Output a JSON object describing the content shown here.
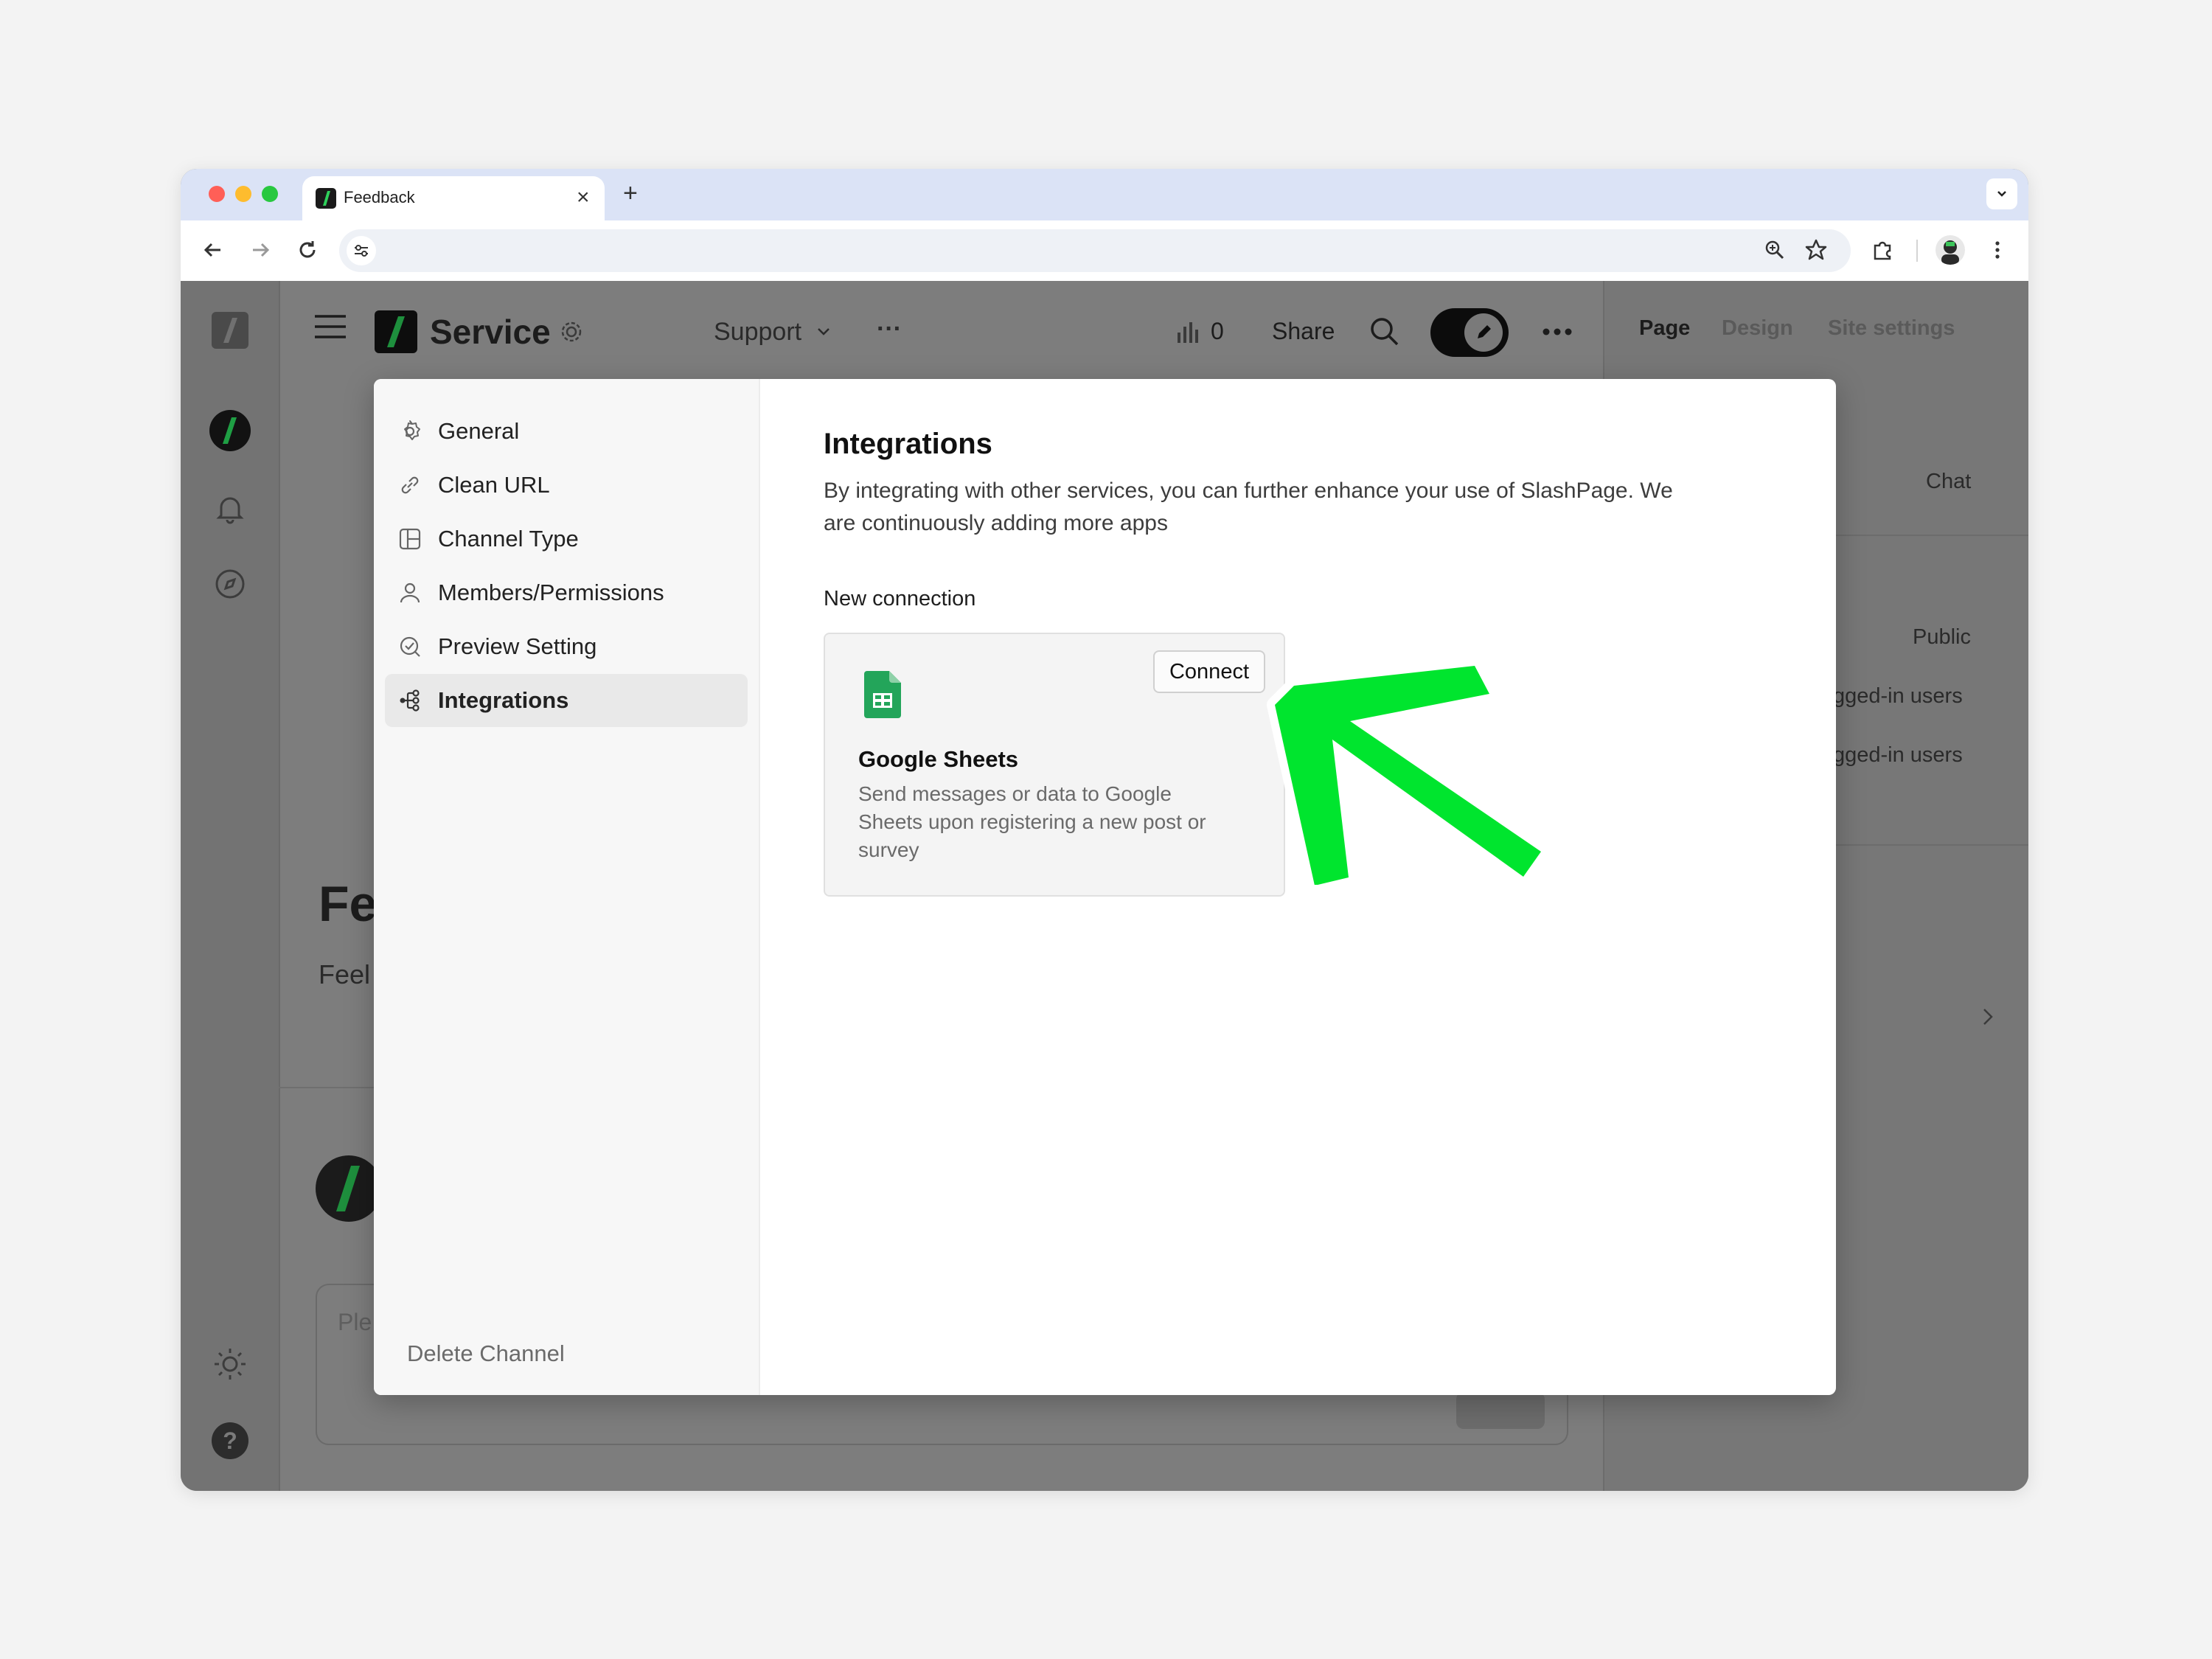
{
  "browser": {
    "tab_title": "Feedback",
    "tab_close": "×",
    "new_tab": "+"
  },
  "app": {
    "site_name": "Service",
    "nav_support": "Support",
    "nav_more": "···",
    "stats_count": "0",
    "share_label": "Share",
    "right_tabs": [
      "Page",
      "Design",
      "Site settings"
    ],
    "right_chat": "Chat",
    "right_public": "Public",
    "right_users_1": "gged-in users",
    "right_users_2": "gged-in users",
    "page_title_partial": "Fe",
    "page_desc_partial": "Feel",
    "composer_placeholder_partial": "Ple"
  },
  "modal": {
    "menu": [
      {
        "label": "General",
        "icon": "gear-icon"
      },
      {
        "label": "Clean URL",
        "icon": "link-icon"
      },
      {
        "label": "Channel Type",
        "icon": "layout-icon"
      },
      {
        "label": "Members/Permissions",
        "icon": "person-icon"
      },
      {
        "label": "Preview Setting",
        "icon": "preview-icon"
      },
      {
        "label": "Integrations",
        "icon": "integrations-icon",
        "active": true
      }
    ],
    "delete_label": "Delete Channel",
    "heading": "Integrations",
    "description_line1": "By integrating with other services, you can further enhance your use of SlashPage. We",
    "description_line2": "are continuously adding more apps",
    "section_label": "New connection",
    "integration": {
      "name": "Google Sheets",
      "desc_line1": "Send messages or data to Google",
      "desc_line2": "Sheets upon registering a new post or",
      "desc_line3": "survey",
      "button": "Connect",
      "icon": "google-sheets-icon"
    }
  },
  "colors": {
    "annotation_arrow": "#00e52e",
    "brand_green": "#1fa84a",
    "sheets_green": "#23a55a"
  }
}
